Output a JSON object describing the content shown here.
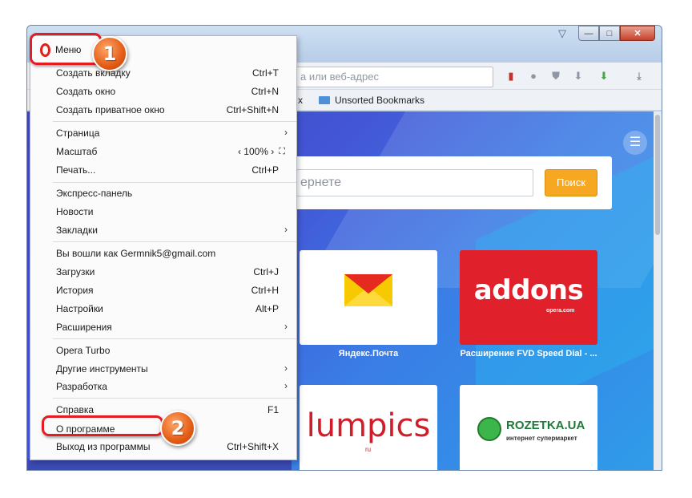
{
  "window": {
    "minimize": "—",
    "maximize": "□",
    "close": "✕",
    "tab_menu_icon": "tab-list-icon"
  },
  "toolbar": {
    "address_placeholder": "а или веб-адрес"
  },
  "bookmarks_bar": {
    "other_fragment": "x",
    "unsorted": "Unsorted Bookmarks"
  },
  "speed_dial": {
    "search_placeholder": "ернете",
    "search_button": "Поиск",
    "tiles": [
      {
        "label": "Яндекс.Почта"
      },
      {
        "label": "Расширение FVD Speed Dial - ...",
        "word": "addons",
        "sub": "opera.com"
      },
      {
        "word": "lumpics",
        "sub": "ru"
      },
      {
        "word": "ROZETKA.UA",
        "sub": "интернет супермаркет"
      }
    ]
  },
  "menu": {
    "title": "Меню",
    "items": [
      {
        "label": "Создать вкладку",
        "shortcut": "Ctrl+T"
      },
      {
        "label": "Создать окно",
        "shortcut": "Ctrl+N"
      },
      {
        "label": "Создать приватное окно",
        "shortcut": "Ctrl+Shift+N"
      },
      {
        "label": "Страница",
        "shortcut": ""
      },
      {
        "label": "Масштаб",
        "shortcut": "‹ 100% ›"
      },
      {
        "label": "Печать...",
        "shortcut": "Ctrl+P"
      },
      {
        "label": "Экспресс-панель",
        "shortcut": ""
      },
      {
        "label": "Новости",
        "shortcut": ""
      },
      {
        "label": "Закладки",
        "shortcut": ""
      },
      {
        "label": "Вы вошли как Germnik5@gmail.com",
        "shortcut": ""
      },
      {
        "label": "Загрузки",
        "shortcut": "Ctrl+J"
      },
      {
        "label": "История",
        "shortcut": "Ctrl+H"
      },
      {
        "label": "Настройки",
        "shortcut": "Alt+P"
      },
      {
        "label": "Расширения",
        "shortcut": ""
      },
      {
        "label": "Opera Turbo",
        "shortcut": ""
      },
      {
        "label": "Другие инструменты",
        "shortcut": ""
      },
      {
        "label": "Разработка",
        "shortcut": ""
      },
      {
        "label": "Справка",
        "shortcut": "F1"
      },
      {
        "label": "О программе",
        "shortcut": ""
      },
      {
        "label": "Выход из программы",
        "shortcut": "Ctrl+Shift+X"
      }
    ]
  },
  "annotations": {
    "step1": "1",
    "step2": "2",
    "ring_color": "#e41c23",
    "badge_color": "#e45c16"
  }
}
